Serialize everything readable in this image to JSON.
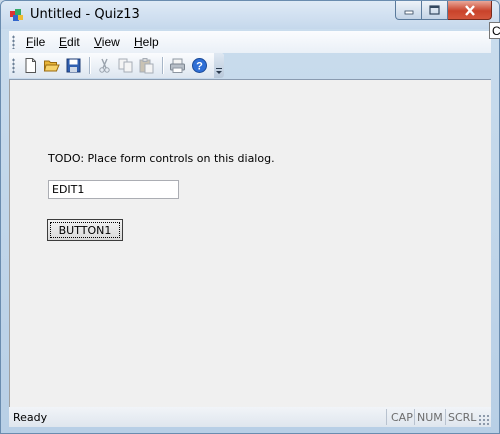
{
  "window": {
    "title": "Untitled - Quiz13"
  },
  "caption": {
    "minimize": "minimize-icon",
    "maximize": "maximize-icon",
    "close": "close-icon"
  },
  "menu": {
    "items": [
      {
        "acc": "F",
        "rest": "ile"
      },
      {
        "acc": "E",
        "rest": "dit"
      },
      {
        "acc": "V",
        "rest": "iew"
      },
      {
        "acc": "H",
        "rest": "elp"
      }
    ]
  },
  "toolbar": {
    "icons": [
      "new-file-icon",
      "open-folder-icon",
      "save-icon",
      "cut-icon",
      "copy-icon",
      "paste-icon",
      "print-icon",
      "help-icon",
      "toolbar-overflow-icon"
    ]
  },
  "dialog": {
    "todo_text": "TODO: Place form controls on this dialog.",
    "edit_value": "EDIT1",
    "button_label": "BUTTON1"
  },
  "status": {
    "ready": "Ready",
    "indicators": [
      "CAP",
      "NUM",
      "SCRL"
    ]
  },
  "tooltip_fragment": "C",
  "colors": {
    "close_button": "#c9432b",
    "client_bg": "#f0f0f0",
    "frame": "#c9dced"
  }
}
